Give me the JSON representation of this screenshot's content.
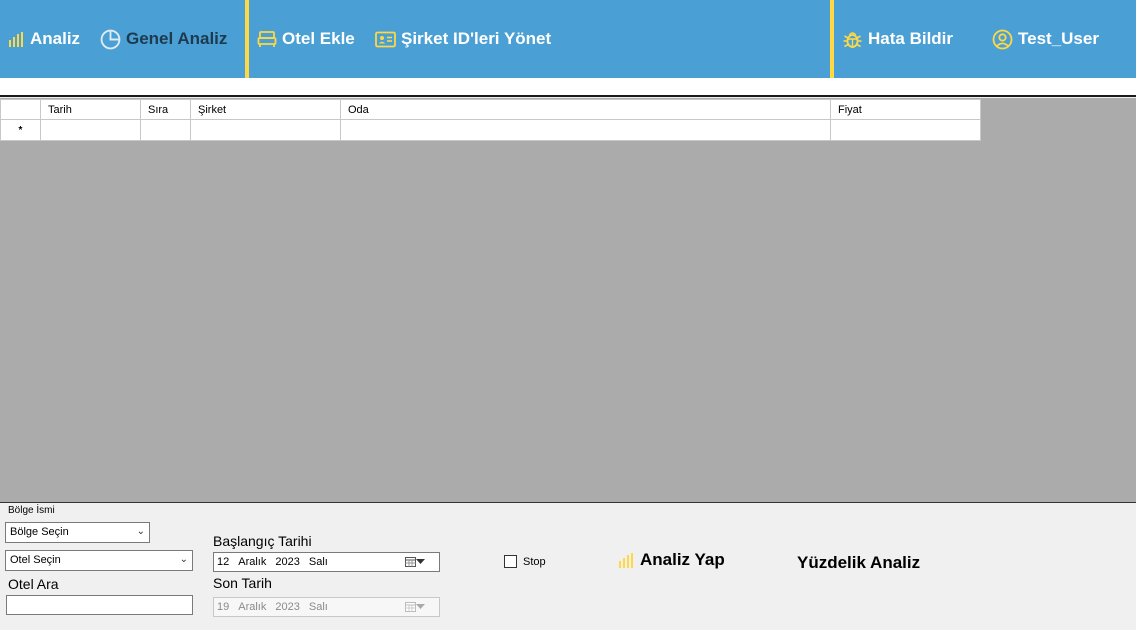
{
  "nav": {
    "analiz": "Analiz",
    "genel_analiz": "Genel Analiz",
    "otel_ekle": "Otel Ekle",
    "sirket_id": "Şirket ID'leri Yönet",
    "hata_bildir": "Hata Bildir",
    "user": "Test_User"
  },
  "colors": {
    "nav_bg": "#4a9fd5",
    "accent": "#ffd843",
    "grid_bg": "#ababab"
  },
  "grid": {
    "columns": [
      "Tarih",
      "Sıra",
      "Şirket",
      "Oda",
      "Fiyat"
    ],
    "new_row_marker": "*"
  },
  "filters": {
    "bolge_label": "Bölge İsmi",
    "bolge_select": "Bölge Seçin",
    "otel_select": "Otel Seçin",
    "otel_ara_label": "Otel Ara",
    "otel_ara_value": "",
    "start_label": "Başlangıç Tarihi",
    "start_date": {
      "day": "12",
      "month": "Aralık",
      "year": "2023",
      "weekday": "Salı"
    },
    "end_label": "Son Tarih",
    "end_date": {
      "day": "19",
      "month": "Aralık",
      "year": "2023",
      "weekday": "Salı"
    },
    "stop_label": "Stop",
    "stop_checked": false
  },
  "actions": {
    "analiz_yap": "Analiz Yap",
    "yuzdelik": "Yüzdelik Analiz"
  },
  "icons": [
    "bar-chart-icon",
    "pie-chart-icon",
    "bed-icon",
    "id-card-icon",
    "bug-icon",
    "user-circle-icon",
    "calendar-icon",
    "chevron-down-icon"
  ]
}
